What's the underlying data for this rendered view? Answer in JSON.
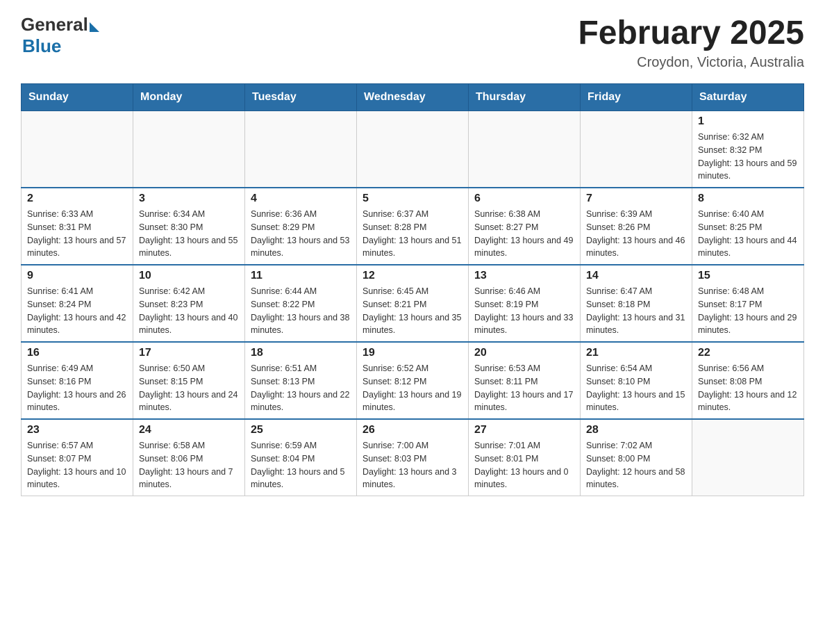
{
  "header": {
    "title": "February 2025",
    "subtitle": "Croydon, Victoria, Australia"
  },
  "logo": {
    "general": "General",
    "blue": "Blue"
  },
  "days_of_week": [
    "Sunday",
    "Monday",
    "Tuesday",
    "Wednesday",
    "Thursday",
    "Friday",
    "Saturday"
  ],
  "weeks": [
    {
      "days": [
        {
          "date": "",
          "info": ""
        },
        {
          "date": "",
          "info": ""
        },
        {
          "date": "",
          "info": ""
        },
        {
          "date": "",
          "info": ""
        },
        {
          "date": "",
          "info": ""
        },
        {
          "date": "",
          "info": ""
        },
        {
          "date": "1",
          "info": "Sunrise: 6:32 AM\nSunset: 8:32 PM\nDaylight: 13 hours and 59 minutes."
        }
      ]
    },
    {
      "days": [
        {
          "date": "2",
          "info": "Sunrise: 6:33 AM\nSunset: 8:31 PM\nDaylight: 13 hours and 57 minutes."
        },
        {
          "date": "3",
          "info": "Sunrise: 6:34 AM\nSunset: 8:30 PM\nDaylight: 13 hours and 55 minutes."
        },
        {
          "date": "4",
          "info": "Sunrise: 6:36 AM\nSunset: 8:29 PM\nDaylight: 13 hours and 53 minutes."
        },
        {
          "date": "5",
          "info": "Sunrise: 6:37 AM\nSunset: 8:28 PM\nDaylight: 13 hours and 51 minutes."
        },
        {
          "date": "6",
          "info": "Sunrise: 6:38 AM\nSunset: 8:27 PM\nDaylight: 13 hours and 49 minutes."
        },
        {
          "date": "7",
          "info": "Sunrise: 6:39 AM\nSunset: 8:26 PM\nDaylight: 13 hours and 46 minutes."
        },
        {
          "date": "8",
          "info": "Sunrise: 6:40 AM\nSunset: 8:25 PM\nDaylight: 13 hours and 44 minutes."
        }
      ]
    },
    {
      "days": [
        {
          "date": "9",
          "info": "Sunrise: 6:41 AM\nSunset: 8:24 PM\nDaylight: 13 hours and 42 minutes."
        },
        {
          "date": "10",
          "info": "Sunrise: 6:42 AM\nSunset: 8:23 PM\nDaylight: 13 hours and 40 minutes."
        },
        {
          "date": "11",
          "info": "Sunrise: 6:44 AM\nSunset: 8:22 PM\nDaylight: 13 hours and 38 minutes."
        },
        {
          "date": "12",
          "info": "Sunrise: 6:45 AM\nSunset: 8:21 PM\nDaylight: 13 hours and 35 minutes."
        },
        {
          "date": "13",
          "info": "Sunrise: 6:46 AM\nSunset: 8:19 PM\nDaylight: 13 hours and 33 minutes."
        },
        {
          "date": "14",
          "info": "Sunrise: 6:47 AM\nSunset: 8:18 PM\nDaylight: 13 hours and 31 minutes."
        },
        {
          "date": "15",
          "info": "Sunrise: 6:48 AM\nSunset: 8:17 PM\nDaylight: 13 hours and 29 minutes."
        }
      ]
    },
    {
      "days": [
        {
          "date": "16",
          "info": "Sunrise: 6:49 AM\nSunset: 8:16 PM\nDaylight: 13 hours and 26 minutes."
        },
        {
          "date": "17",
          "info": "Sunrise: 6:50 AM\nSunset: 8:15 PM\nDaylight: 13 hours and 24 minutes."
        },
        {
          "date": "18",
          "info": "Sunrise: 6:51 AM\nSunset: 8:13 PM\nDaylight: 13 hours and 22 minutes."
        },
        {
          "date": "19",
          "info": "Sunrise: 6:52 AM\nSunset: 8:12 PM\nDaylight: 13 hours and 19 minutes."
        },
        {
          "date": "20",
          "info": "Sunrise: 6:53 AM\nSunset: 8:11 PM\nDaylight: 13 hours and 17 minutes."
        },
        {
          "date": "21",
          "info": "Sunrise: 6:54 AM\nSunset: 8:10 PM\nDaylight: 13 hours and 15 minutes."
        },
        {
          "date": "22",
          "info": "Sunrise: 6:56 AM\nSunset: 8:08 PM\nDaylight: 13 hours and 12 minutes."
        }
      ]
    },
    {
      "days": [
        {
          "date": "23",
          "info": "Sunrise: 6:57 AM\nSunset: 8:07 PM\nDaylight: 13 hours and 10 minutes."
        },
        {
          "date": "24",
          "info": "Sunrise: 6:58 AM\nSunset: 8:06 PM\nDaylight: 13 hours and 7 minutes."
        },
        {
          "date": "25",
          "info": "Sunrise: 6:59 AM\nSunset: 8:04 PM\nDaylight: 13 hours and 5 minutes."
        },
        {
          "date": "26",
          "info": "Sunrise: 7:00 AM\nSunset: 8:03 PM\nDaylight: 13 hours and 3 minutes."
        },
        {
          "date": "27",
          "info": "Sunrise: 7:01 AM\nSunset: 8:01 PM\nDaylight: 13 hours and 0 minutes."
        },
        {
          "date": "28",
          "info": "Sunrise: 7:02 AM\nSunset: 8:00 PM\nDaylight: 12 hours and 58 minutes."
        },
        {
          "date": "",
          "info": ""
        }
      ]
    }
  ]
}
